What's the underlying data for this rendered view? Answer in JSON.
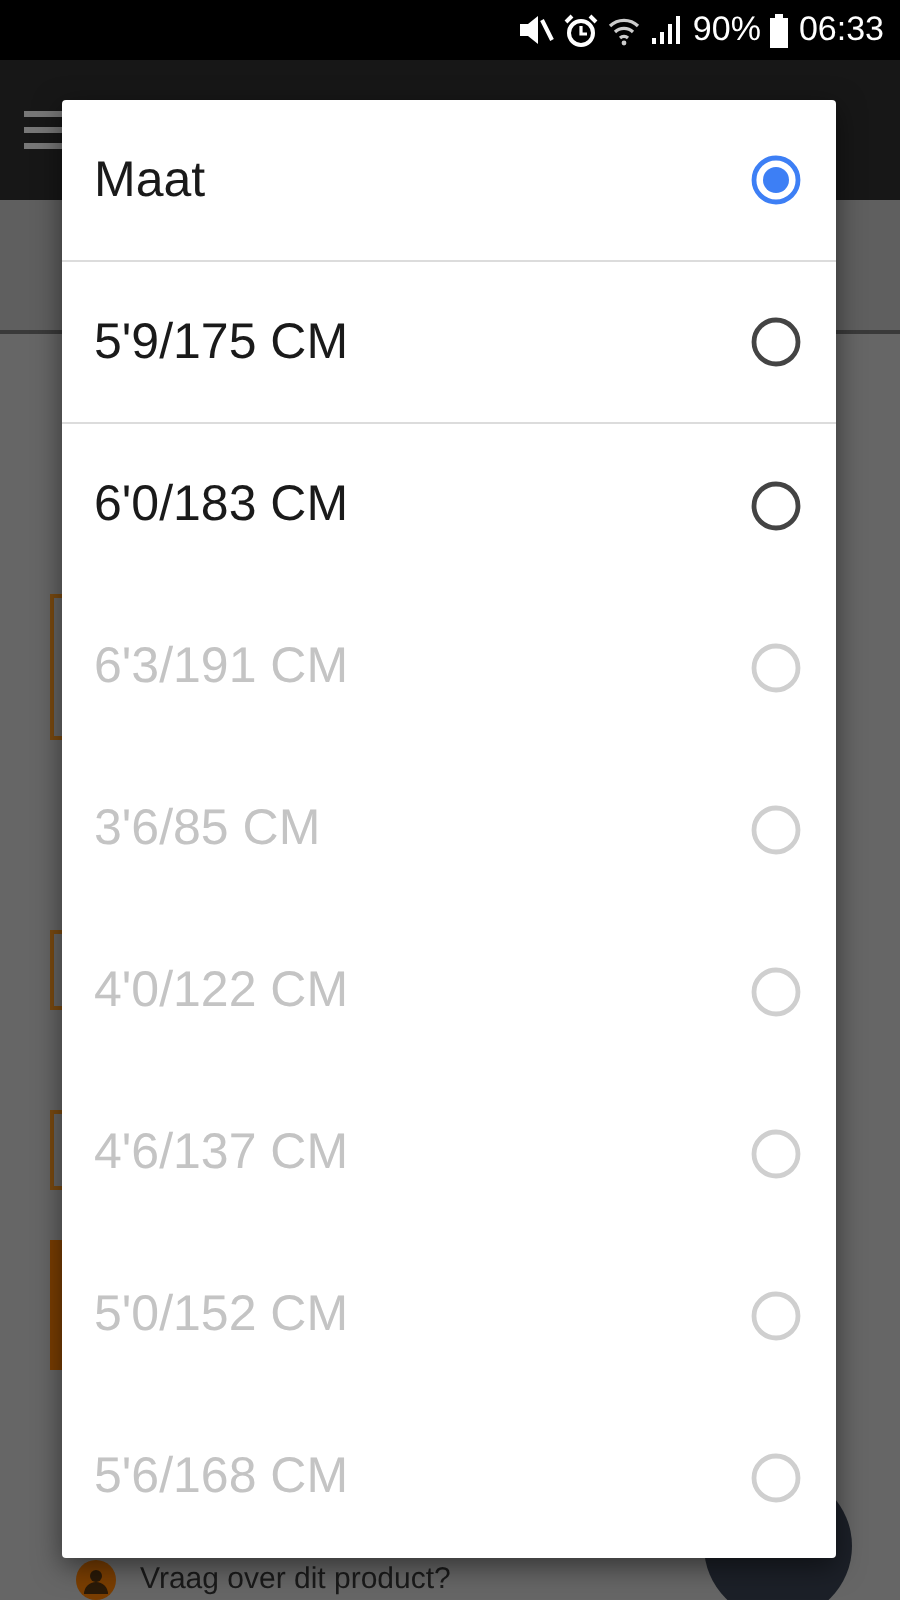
{
  "status_bar": {
    "battery": "90%",
    "time": "06:33"
  },
  "page": {
    "items": [
      {
        "kind": "field"
      },
      {
        "kind": "field"
      },
      {
        "kind": "field"
      },
      {
        "kind": "button"
      }
    ],
    "question_link": "Vraag over dit product?"
  },
  "dialog": {
    "options": [
      {
        "label": "Maat",
        "selected": true,
        "disabled": false,
        "divider": true
      },
      {
        "label": "5'9/175 CM",
        "selected": false,
        "disabled": false,
        "divider": true
      },
      {
        "label": "6'0/183 CM",
        "selected": false,
        "disabled": false,
        "divider": false
      },
      {
        "label": "6'3/191 CM",
        "selected": false,
        "disabled": true,
        "divider": false
      },
      {
        "label": "3'6/85 CM",
        "selected": false,
        "disabled": true,
        "divider": false
      },
      {
        "label": "4'0/122 CM",
        "selected": false,
        "disabled": true,
        "divider": false
      },
      {
        "label": "4'6/137 CM",
        "selected": false,
        "disabled": true,
        "divider": false
      },
      {
        "label": "5'0/152 CM",
        "selected": false,
        "disabled": true,
        "divider": false
      },
      {
        "label": "5'6/168 CM",
        "selected": false,
        "disabled": true,
        "divider": false
      }
    ]
  }
}
